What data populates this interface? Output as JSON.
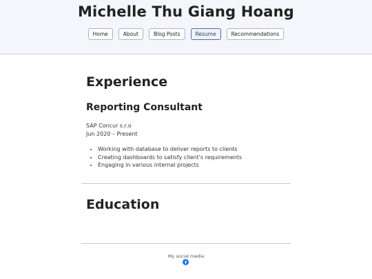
{
  "site": {
    "title": "Michelle Thu Giang Hoang"
  },
  "nav": {
    "items": [
      {
        "label": "Home"
      },
      {
        "label": "About"
      },
      {
        "label": "Blog Posts"
      },
      {
        "label": "Resume",
        "active": true
      },
      {
        "label": "Recommendations"
      }
    ]
  },
  "experience": {
    "heading": "Experience",
    "job_title": "Reporting Consultant",
    "company": "SAP Concur s.r.o",
    "dates": "Jun 2020 – Present",
    "bullets": [
      "Working with database to deliver reports to clients",
      "Creating dashboards to satisfy client's requirements",
      "Engaging in various internal projects"
    ]
  },
  "education": {
    "heading": "Education"
  },
  "footer": {
    "social_label": "My social media",
    "icon": "facebook-icon"
  },
  "colors": {
    "header_bg": "#f4f6fc",
    "active_border": "#5a6c92",
    "facebook_blue": "#1877f2"
  }
}
